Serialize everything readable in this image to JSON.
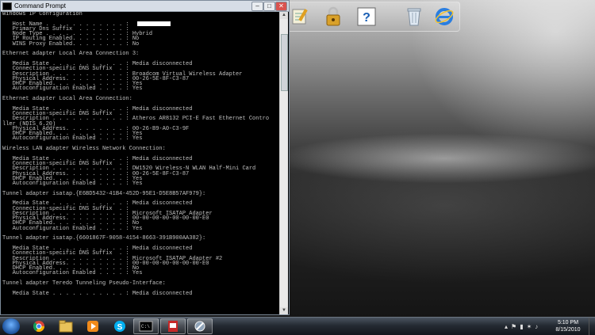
{
  "window": {
    "title": "Command Prompt",
    "minimize_label": "–",
    "maximize_label": "□",
    "close_label": "✕"
  },
  "console_lines": [
    "Windows IP Configuration",
    "",
    "   Host Name . . . . . . . . . . . . :        -PC",
    "   Primary Dns Suffix  . . . . . . . :",
    "   Node Type . . . . . . . . . . . . : Hybrid",
    "   IP Routing Enabled. . . . . . . . : No",
    "   WINS Proxy Enabled. . . . . . . . : No",
    "",
    "Ethernet adapter Local Area Connection 3:",
    "",
    "   Media State . . . . . . . . . . . : Media disconnected",
    "   Connection-specific DNS Suffix  . :",
    "   Description . . . . . . . . . . . : Broadcom Virtual Wireless Adapter",
    "   Physical Address. . . . . . . . . : 00-26-5E-8F-C3-87",
    "   DHCP Enabled. . . . . . . . . . . : Yes",
    "   Autoconfiguration Enabled . . . . : Yes",
    "",
    "Ethernet adapter Local Area Connection:",
    "",
    "   Media State . . . . . . . . . . . : Media disconnected",
    "   Connection-specific DNS Suffix  . :",
    "   Description . . . . . . . . . . . : Atheros AR8132 PCI-E Fast Ethernet Contro",
    "ller (NDIS 6.20)",
    "   Physical Address. . . . . . . . . : 00-26-B9-A0-C3-9F",
    "   DHCP Enabled. . . . . . . . . . . : Yes",
    "   Autoconfiguration Enabled . . . . : Yes",
    "",
    "Wireless LAN adapter Wireless Network Connection:",
    "",
    "   Media State . . . . . . . . . . . : Media disconnected",
    "   Connection-specific DNS Suffix  . :",
    "   Description . . . . . . . . . . . : DW1520 Wireless-N WLAN Half-Mini Card",
    "   Physical Address. . . . . . . . . : 00-26-5E-8F-C3-87",
    "   DHCP Enabled. . . . . . . . . . . : Yes",
    "   Autoconfiguration Enabled . . . . : Yes",
    "",
    "Tunnel adapter isatap.{E6BD5432-41B4-452D-95E1-D5E8B57AF979}:",
    "",
    "   Media State . . . . . . . . . . . : Media disconnected",
    "   Connection-specific DNS Suffix  . :",
    "   Description . . . . . . . . . . . : Microsoft ISATAP Adapter",
    "   Physical Address. . . . . . . . . : 00-00-00-00-00-00-00-E0",
    "   DHCP Enabled. . . . . . . . . . . : No",
    "   Autoconfiguration Enabled . . . . : Yes",
    "",
    "Tunnel adapter isatap.{6601867F-9058-4154-8663-391B900AA382}:",
    "",
    "   Media State . . . . . . . . . . . : Media disconnected",
    "   Connection-specific DNS Suffix  . :",
    "   Description . . . . . . . . . . . : Microsoft ISATAP Adapter #2",
    "   Physical Address. . . . . . . . . : 00-00-00-00-00-00-00-E0",
    "   DHCP Enabled. . . . . . . . . . . : No",
    "   Autoconfiguration Enabled . . . . : Yes",
    "",
    "Tunnel adapter Teredo Tunneling Pseudo-Interface:",
    "",
    "   Media State . . . . . . . . . . . : Media disconnected"
  ],
  "scrollbar": {
    "up_arrow": "▲",
    "down_arrow": "▼"
  },
  "clock": {
    "time": "5:10 PM",
    "date": "8/15/2010"
  },
  "colors": {
    "console_bg": "#000000",
    "console_text": "#c0c0c0",
    "taskbar": "#1c2229"
  },
  "taskbar_items": [
    "start-orb",
    "chrome",
    "explorer",
    "media-player",
    "skype",
    "command-prompt",
    "pdf-reader",
    "control-panel"
  ],
  "dock_icons": [
    "notepad-pencil",
    "lock",
    "help",
    "recycle-bin",
    "internet-explorer"
  ]
}
